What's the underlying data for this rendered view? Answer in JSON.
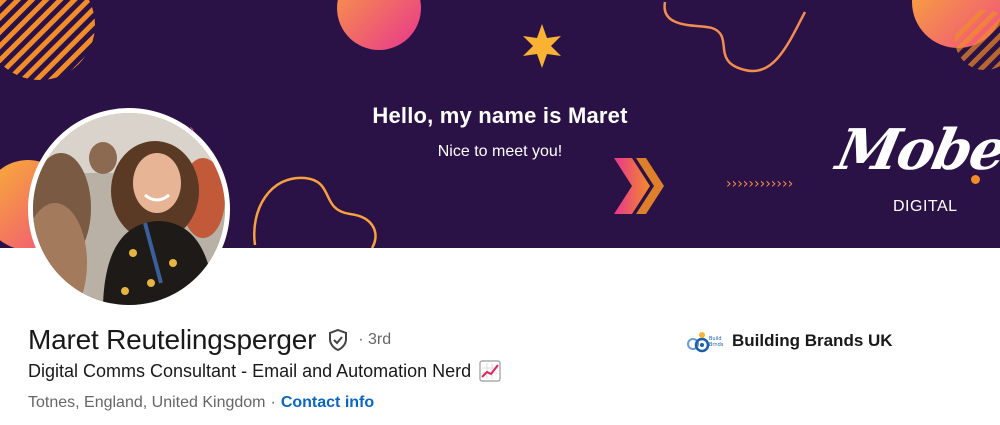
{
  "banner": {
    "headline": "Hello, my name is Maret",
    "subheadline": "Nice to meet you!",
    "brand_script": "Mobe",
    "brand_word": "DIGITAL",
    "colors": {
      "background": "#2a1246",
      "accent_orange": "#f28c28",
      "accent_pink": "#e83e8c",
      "accent_yellow": "#f9b233"
    }
  },
  "profile": {
    "name": "Maret Reutelingsperger",
    "degree": "· 3rd",
    "headline": "Digital Comms Consultant - Email and Automation Nerd",
    "location": "Totnes, England, United Kingdom",
    "separator": "·",
    "contact_label": "Contact info",
    "verified_icon": "shield-check-icon",
    "headline_emoji_icon": "chart-increasing-icon"
  },
  "company": {
    "name": "Building Brands UK",
    "logo_icon": "building-brands-logo"
  }
}
